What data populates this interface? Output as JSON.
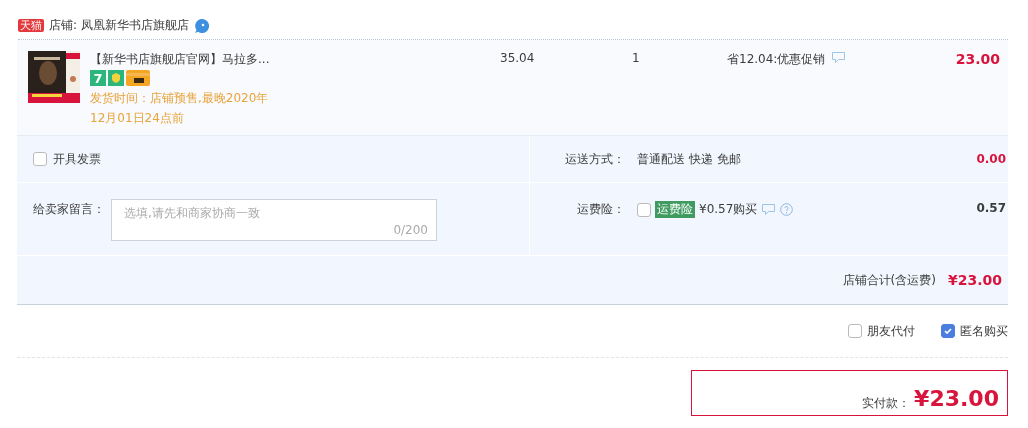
{
  "shop": {
    "badge": "天猫",
    "label": "店铺: 凤凰新华书店旗舰店"
  },
  "item": {
    "title": "【新华书店旗舰店官网】马拉多...",
    "return_badge": "7",
    "shipping_note": "发货时间：店铺预售,最晚2020年12月01日24点前",
    "unit_price": "35.04",
    "quantity": "1",
    "discount": "省12.04:优惠促销",
    "subtotal": "23.00"
  },
  "invoice": {
    "label": "开具发票",
    "checked": false
  },
  "shipping": {
    "label": "运送方式：",
    "method": "普通配送 快递 免邮",
    "fee": "0.00"
  },
  "message": {
    "label": "给卖家留言：",
    "placeholder": "选填,请先和商家协商一致",
    "counter": "0/200"
  },
  "insurance": {
    "label": "运费险：",
    "checked": false,
    "tag": "运费险",
    "price": "¥0.57购买",
    "fee": "0.57"
  },
  "shop_total": {
    "label": "店铺合计(含运费)",
    "amount": "¥23.00"
  },
  "options": [
    {
      "label": "朋友代付",
      "checked": false
    },
    {
      "label": "匿名购买",
      "checked": true
    }
  ],
  "payment": {
    "label": "实付款：",
    "amount": "¥23.00"
  }
}
